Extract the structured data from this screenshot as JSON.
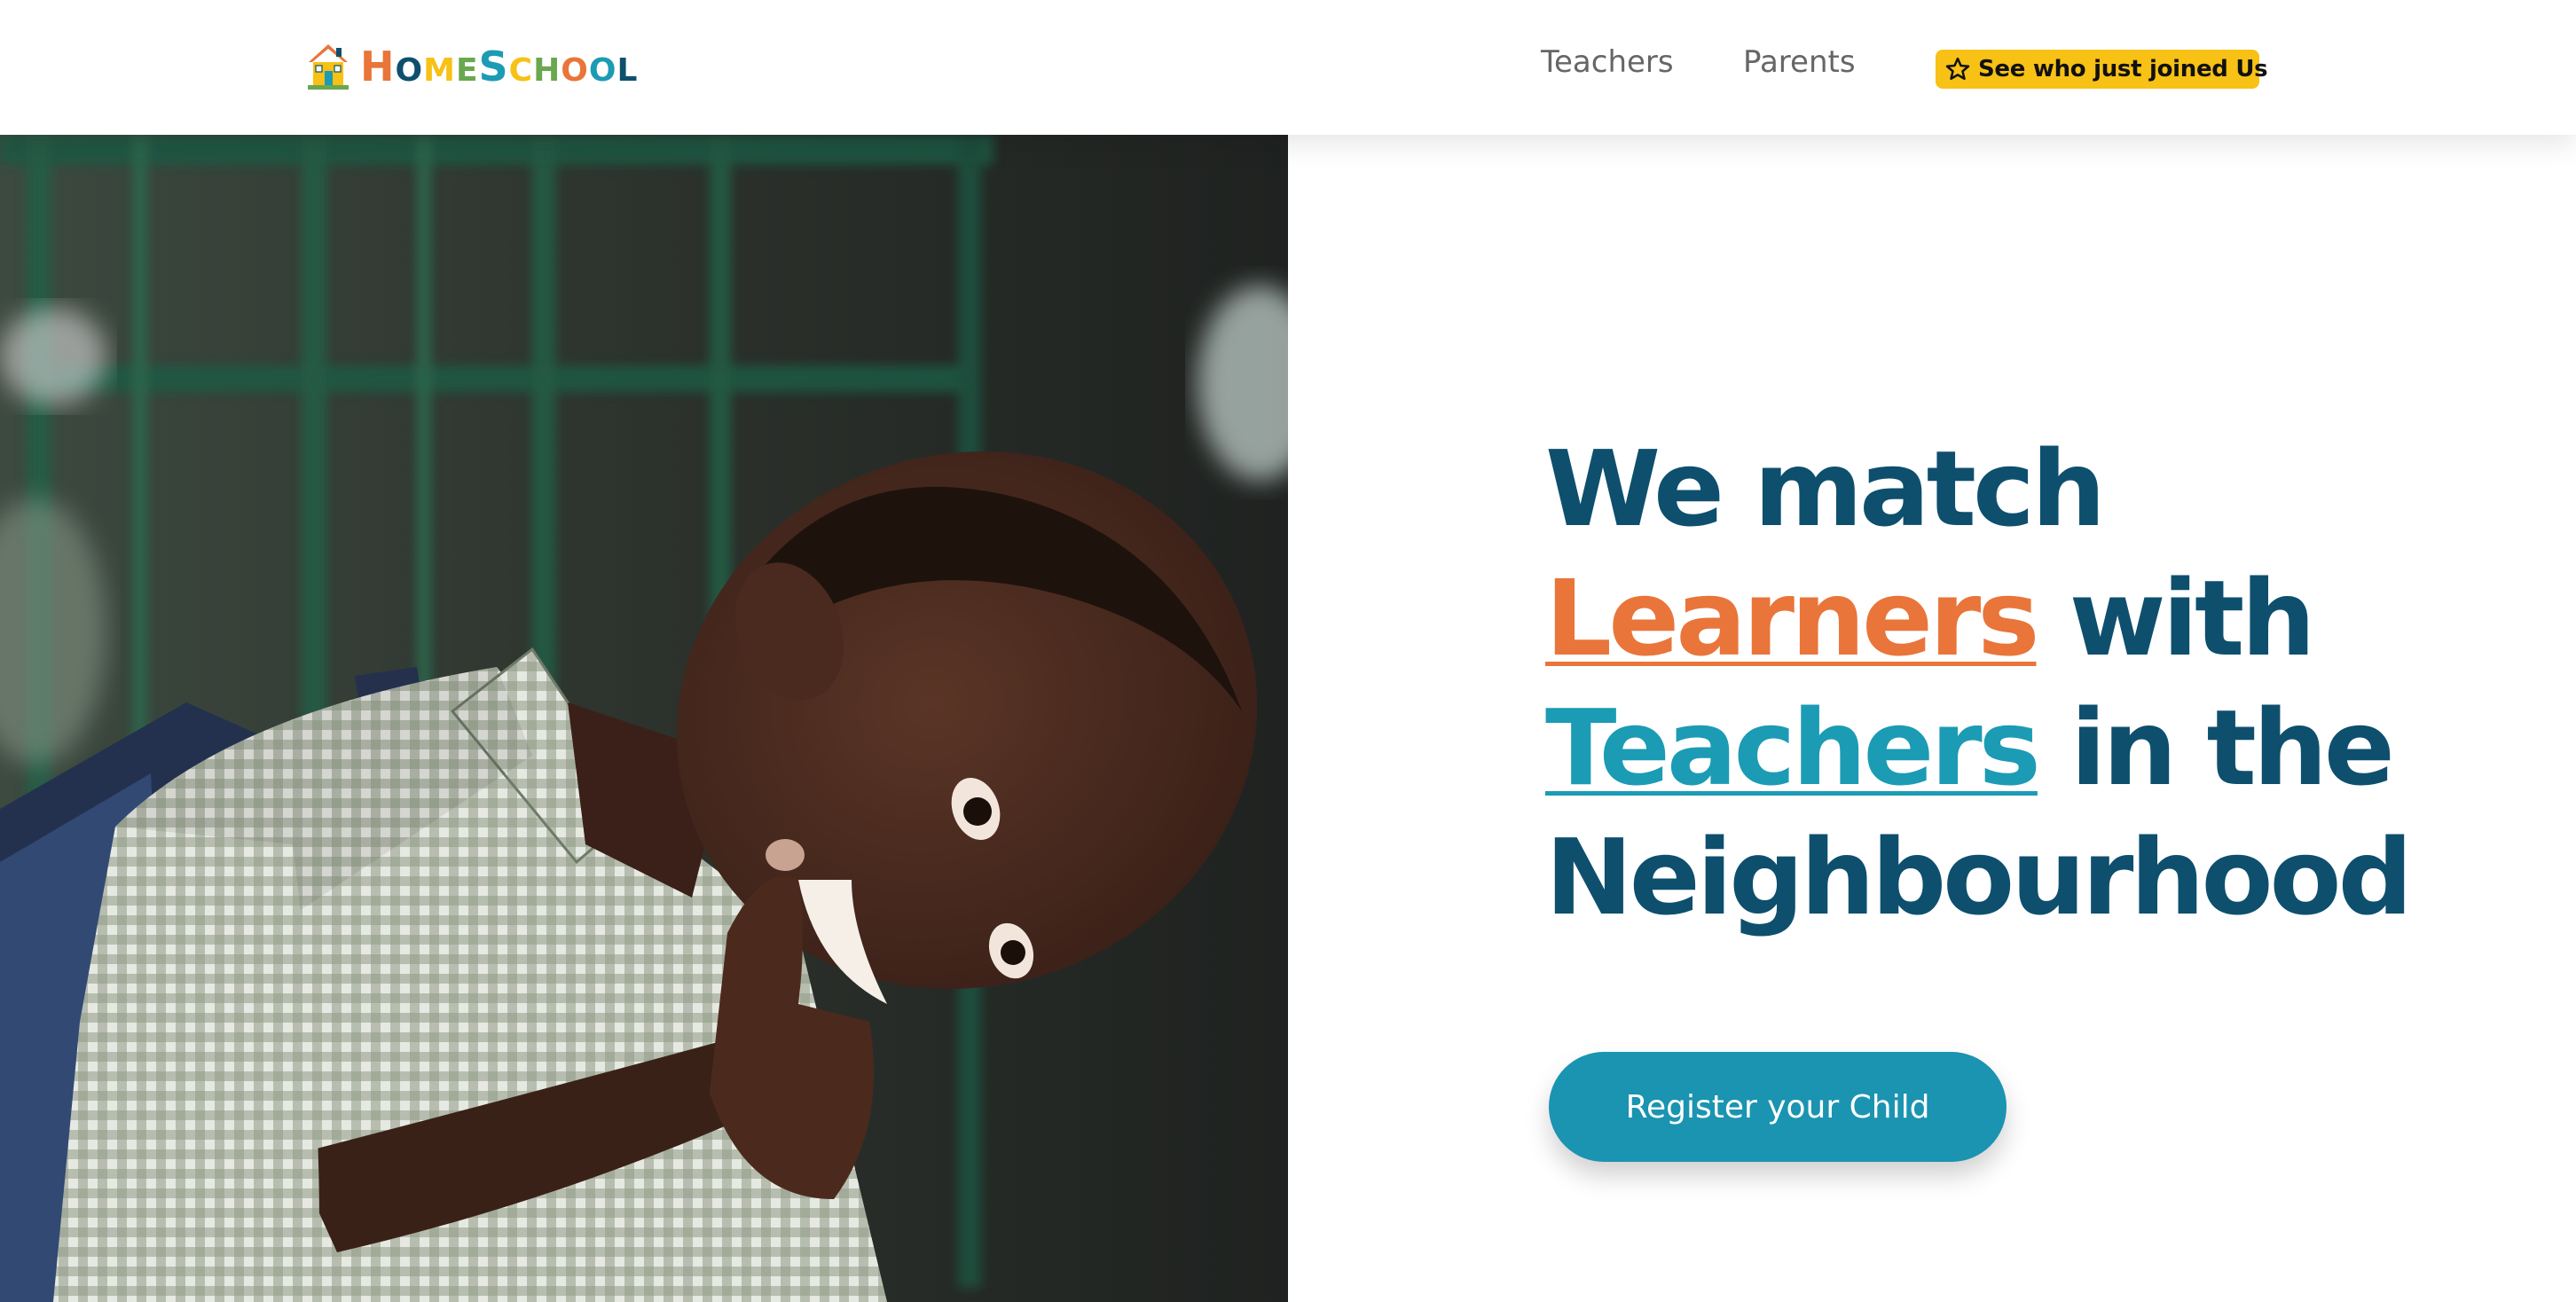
{
  "brand": {
    "logo_parts": [
      "H",
      "OME",
      "S",
      "CHOOL"
    ],
    "logo_colors": [
      "#e9753a",
      "#1c9bb4",
      "#0e4f6e",
      "#f7c115",
      "#69a84f"
    ],
    "logo_icon": "house-icon"
  },
  "nav": {
    "links": [
      {
        "label": "Teachers"
      },
      {
        "label": "Parents"
      }
    ],
    "badge": {
      "icon": "star-icon",
      "label": "See who just joined Us",
      "color": "#f7c115"
    }
  },
  "hero": {
    "image_alt": "boy-with-backpack-photo",
    "headline": {
      "line1": "We match",
      "learners": "Learners",
      "with": " with",
      "teachers": "Teachers",
      "in_the": " in the",
      "line4": "Neighbourhood"
    },
    "colors": {
      "headline": "#0e4f6e",
      "learners": "#e9753a",
      "teachers": "#1c9bb4",
      "button": "#1a94b1"
    },
    "cta_label": "Register your Child"
  }
}
